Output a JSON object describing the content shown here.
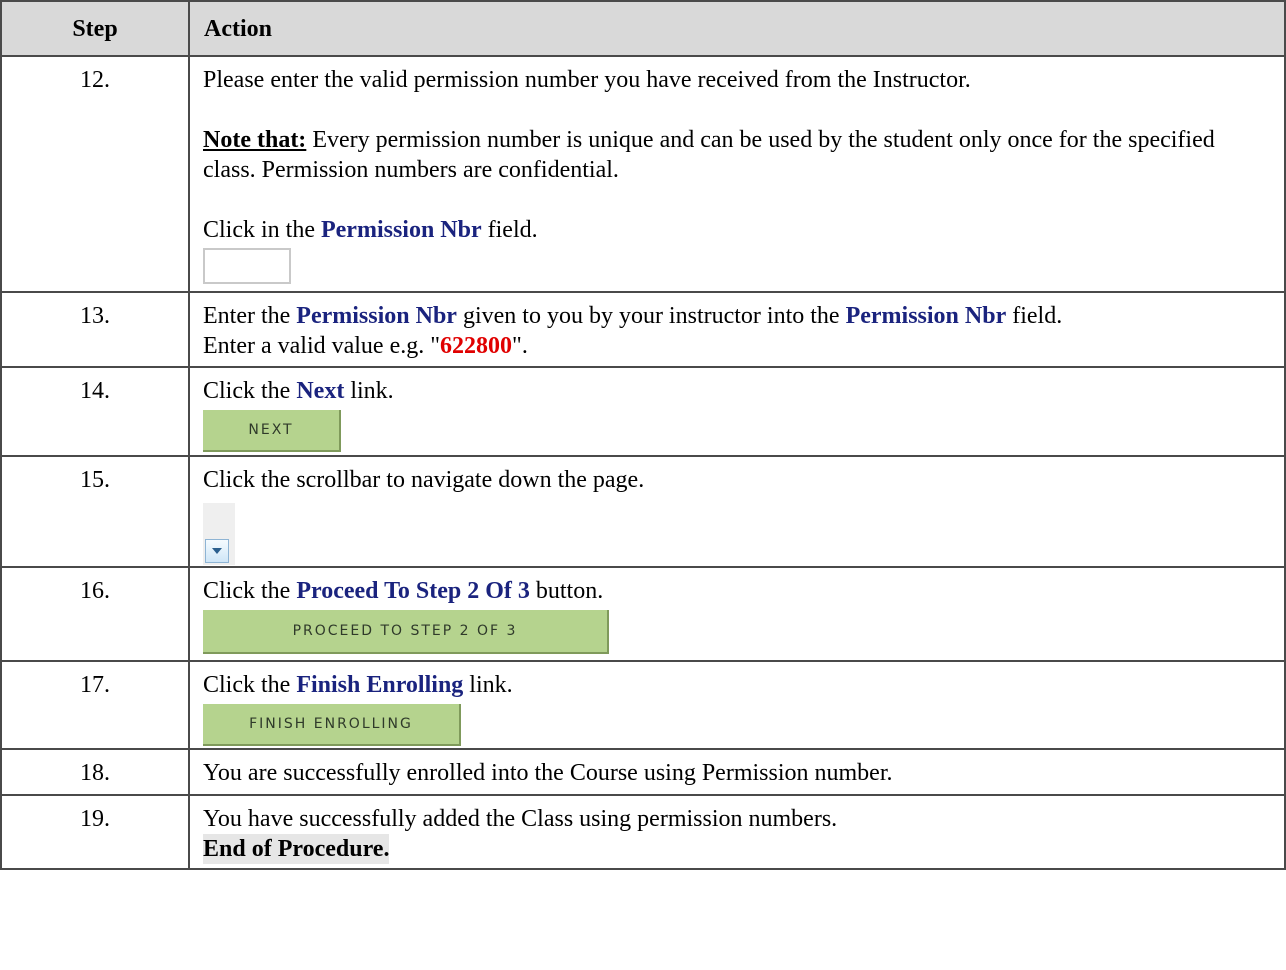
{
  "header": {
    "step": "Step",
    "action": "Action"
  },
  "steps": {
    "s12": {
      "num": "12.",
      "line1": "Please enter the valid permission number you have  received from the Instructor.",
      "note_label": "Note that:",
      "note_text": " Every permission number is unique and can be used by the student only once for the specified class. Permission numbers are confidential.",
      "click_pre": "Click in the ",
      "click_kw": "Permission Nbr",
      "click_post": " field."
    },
    "s13": {
      "num": "13.",
      "pre": "Enter the ",
      "kw1": "Permission Nbr",
      "mid": " given to you by your instructor into the ",
      "kw2": "Permission Nbr",
      "post": " field.",
      "line2_pre": "Enter a valid value e.g. \"",
      "value": "622800",
      "line2_post": "\"."
    },
    "s14": {
      "num": "14.",
      "pre": "Click the ",
      "kw": "Next",
      "post": " link.",
      "button": "Next"
    },
    "s15": {
      "num": "15.",
      "text": "Click the scrollbar to navigate down the page."
    },
    "s16": {
      "num": "16.",
      "pre": "Click the ",
      "kw": "Proceed To Step 2 Of 3",
      "post": " button.",
      "button": "Proceed To Step 2 Of 3"
    },
    "s17": {
      "num": "17.",
      "pre": "Click the ",
      "kw": "Finish Enrolling",
      "post": " link.",
      "button": "Finish Enrolling"
    },
    "s18": {
      "num": "18.",
      "text": "You are successfully enrolled into the Course using Permission number."
    },
    "s19": {
      "num": "19.",
      "text": "You have successfully added the Class using permission numbers.",
      "end": "End of Procedure."
    }
  },
  "colors": {
    "keyword": "#1a237e",
    "value": "#e00000",
    "button_bg": "#b5d38e",
    "header_bg": "#d9d9d9"
  }
}
